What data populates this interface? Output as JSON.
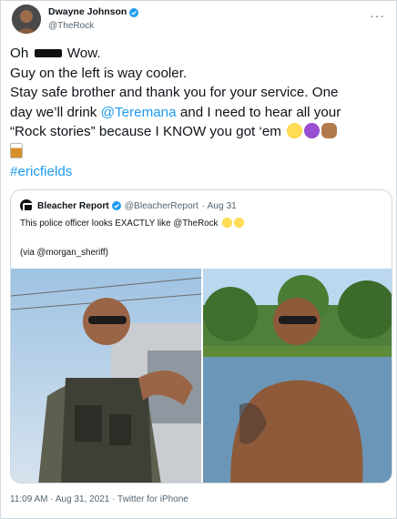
{
  "tweet": {
    "author": {
      "display_name": "Dwayne Johnson",
      "handle": "@TheRock",
      "verified": true
    },
    "lines": {
      "l1_start": "Oh",
      "l1_end": "Wow.",
      "l2": "Guy on the left is way cooler.",
      "l3": "Stay safe brother and thank you for your service. One",
      "l4_start": "day we’ll drink",
      "l4_link": "@Teremana",
      "l4_end": "and I need to hear all your",
      "l5": "“Rock stories” because I KNOW you got ‘em",
      "hashtag": "#ericfields"
    },
    "emojis": [
      "face-with-tears-of-joy",
      "smiling-face-with-horns",
      "oncoming-fist",
      "tumbler-glass"
    ],
    "footer": "11:09 AM · Aug 31, 2021 · Twitter for iPhone"
  },
  "quoted_tweet": {
    "display_name": "Bleacher Report",
    "verified": true,
    "handle": "@BleacherReport",
    "date": "· Aug 31",
    "text": "This police officer looks EXACTLY like @TheRock",
    "via": "(via @morgan_sheriff)",
    "photos": [
      "police-officer-photo",
      "the-rock-lake-photo"
    ]
  },
  "colors": {
    "link": "#1d9bf0",
    "muted": "#536471",
    "border": "#cfd9de",
    "verified": "#1d9bf0"
  }
}
